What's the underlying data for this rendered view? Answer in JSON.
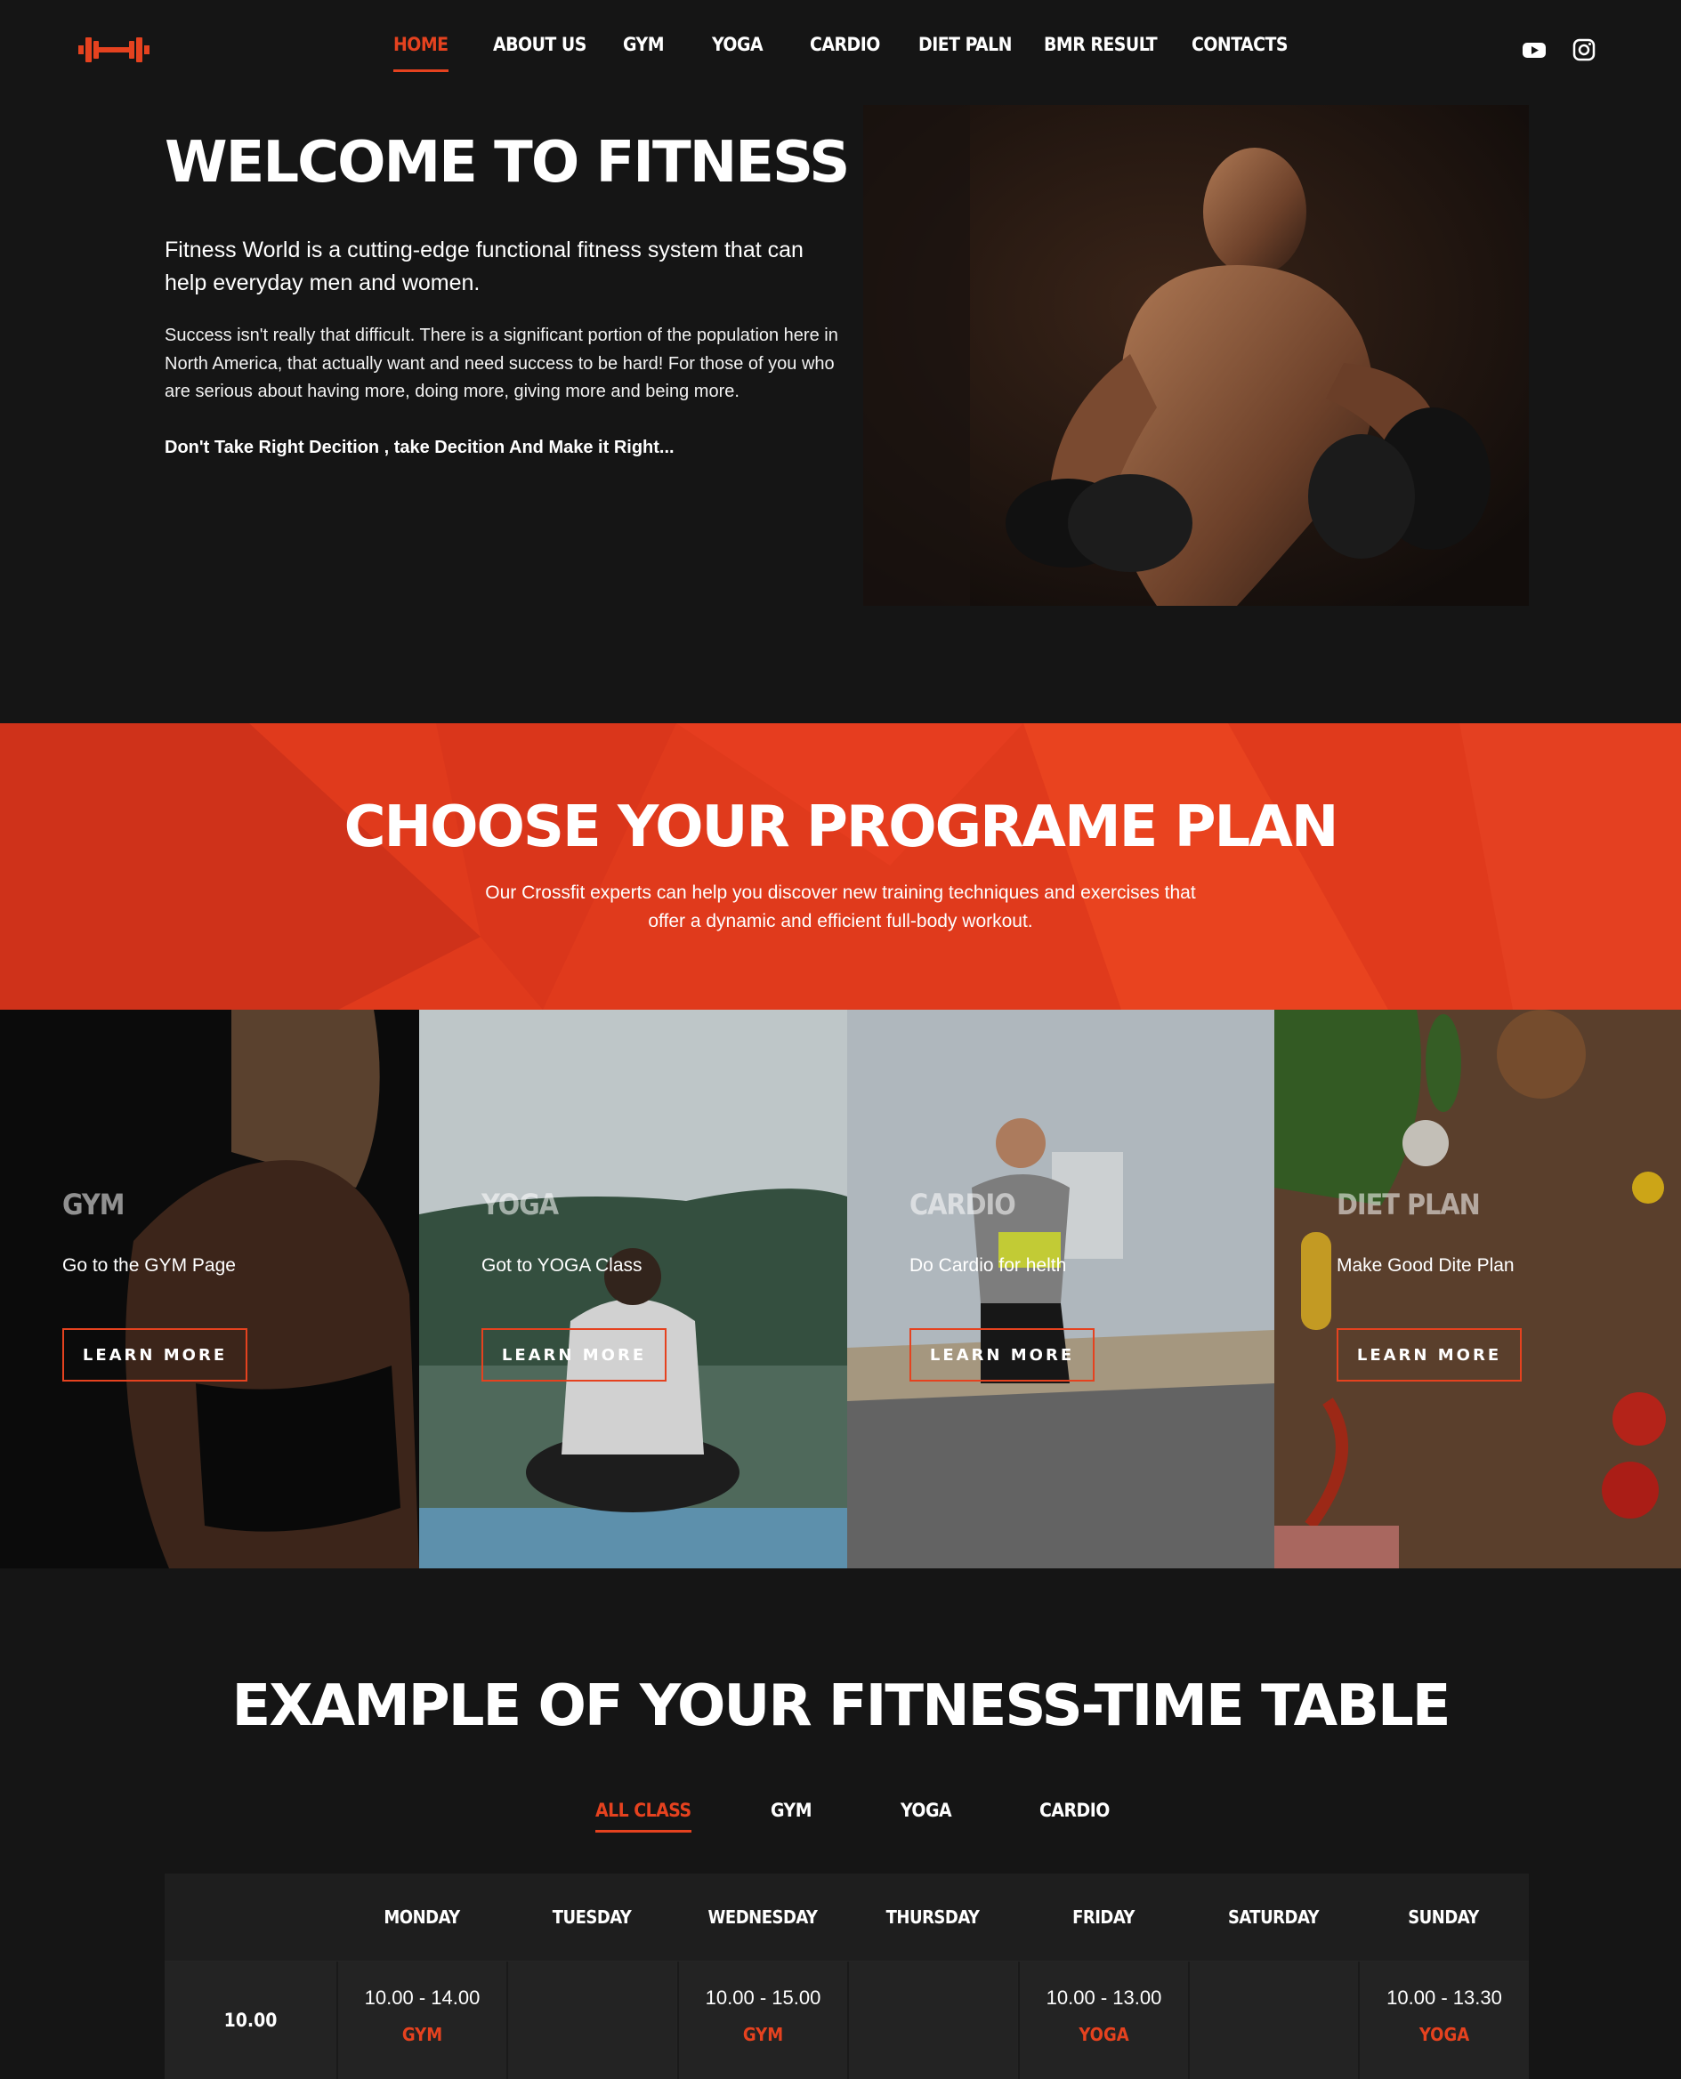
{
  "brand": {
    "accent": "#e5421f",
    "band_color": "#e03a1c",
    "background": "#151515"
  },
  "nav": {
    "items": [
      {
        "label": "HOME",
        "active": true
      },
      {
        "label": "ABOUT US"
      },
      {
        "label": "GYM"
      },
      {
        "label": "YOGA"
      },
      {
        "label": "CARDIO"
      },
      {
        "label": "DIET PALN"
      },
      {
        "label": "BMR RESULT"
      },
      {
        "label": "CONTACTS"
      }
    ],
    "social": [
      "youtube-icon",
      "instagram-icon"
    ]
  },
  "hero": {
    "title": "WELCOME TO FITNESS WORLD",
    "lead": "Fitness World is a cutting-edge functional fitness system that can help everyday men and women.",
    "text": "Success isn't really that difficult. There is a significant portion of the population here in North America, that actually want and need success to be hard! For those of you who are serious about having more, doing more, giving more and being more.",
    "strong": "Don't Take Right Decition , take Decition And Make it Right..."
  },
  "program": {
    "title": "CHOOSE YOUR PROGRAME PLAN",
    "text": "Our Crossfit experts can help you discover new training techniques and exercises that offer a dynamic and efficient full-body workout.",
    "cards": [
      {
        "title": "GYM",
        "text": "Go to the GYM Page",
        "button": "LEARN MORE"
      },
      {
        "title": "YOGA",
        "text": "Got to YOGA Class",
        "button": "LEARN MORE"
      },
      {
        "title": "CARDIO",
        "text": "Do Cardio for helth",
        "button": "LEARN MORE"
      },
      {
        "title": "DIET PLAN",
        "text": "Make Good Dite Plan",
        "button": "LEARN MORE"
      }
    ]
  },
  "timetable": {
    "title": "EXAMPLE OF YOUR FITNESS-TIME TABLE",
    "tabs": [
      {
        "label": "ALL CLASS",
        "active": true
      },
      {
        "label": "GYM"
      },
      {
        "label": "YOGA"
      },
      {
        "label": "CARDIO"
      }
    ],
    "days": [
      "MONDAY",
      "TUESDAY",
      "WEDNESDAY",
      "THURSDAY",
      "FRIDAY",
      "SATURDAY",
      "SUNDAY"
    ],
    "rows": [
      {
        "time": "10.00",
        "slots": [
          {
            "time": "10.00 - 14.00",
            "class": "GYM"
          },
          null,
          {
            "time": "10.00 - 15.00",
            "class": "GYM"
          },
          null,
          {
            "time": "10.00 - 13.00",
            "class": "YOGA"
          },
          null,
          {
            "time": "10.00 - 13.30",
            "class": "YOGA"
          }
        ]
      }
    ]
  }
}
